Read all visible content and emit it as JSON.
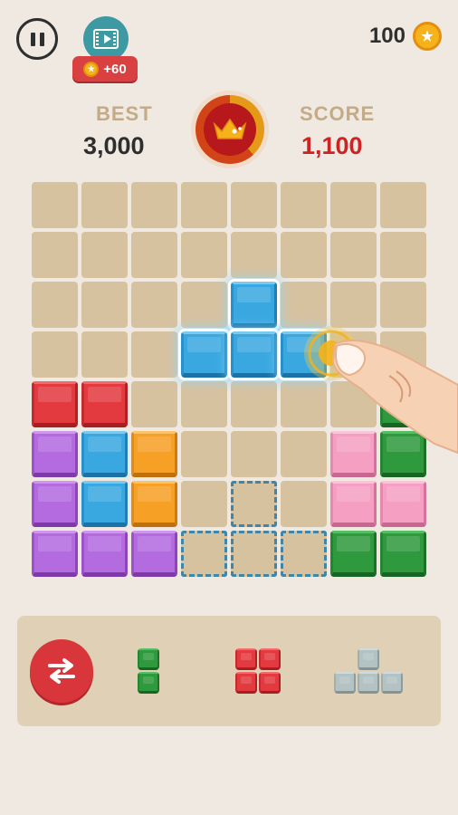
{
  "top_bar": {
    "pause_icon": "pause-icon",
    "video_icon": "video-ad-icon",
    "reward_text": "+60",
    "coins": "100"
  },
  "scores": {
    "best_label": "BEST",
    "best_value": "3,000",
    "score_label": "SCORE",
    "score_value": "1,100",
    "crown_icon": "crown-icon"
  },
  "board": {
    "rows": 8,
    "cols": 8,
    "placed_blocks": [
      {
        "row": 4,
        "col": 0,
        "color": "red"
      },
      {
        "row": 4,
        "col": 1,
        "color": "red"
      },
      {
        "row": 5,
        "col": 0,
        "color": "purple"
      },
      {
        "row": 5,
        "col": 1,
        "color": "blue"
      },
      {
        "row": 5,
        "col": 2,
        "color": "orange"
      },
      {
        "row": 6,
        "col": 0,
        "color": "purple"
      },
      {
        "row": 6,
        "col": 1,
        "color": "blue"
      },
      {
        "row": 6,
        "col": 2,
        "color": "orange"
      },
      {
        "row": 7,
        "col": 0,
        "color": "purple"
      },
      {
        "row": 7,
        "col": 1,
        "color": "purple"
      },
      {
        "row": 7,
        "col": 2,
        "color": "purple"
      },
      {
        "row": 4,
        "col": 7,
        "color": "green"
      },
      {
        "row": 5,
        "col": 6,
        "color": "pink"
      },
      {
        "row": 5,
        "col": 7,
        "color": "green"
      },
      {
        "row": 6,
        "col": 6,
        "color": "pink"
      },
      {
        "row": 6,
        "col": 7,
        "color": "pink"
      },
      {
        "row": 7,
        "col": 6,
        "color": "green"
      },
      {
        "row": 7,
        "col": 7,
        "color": "green"
      }
    ],
    "dragging_piece": [
      {
        "row": 2,
        "col": 4
      },
      {
        "row": 3,
        "col": 3
      },
      {
        "row": 3,
        "col": 4
      },
      {
        "row": 3,
        "col": 5
      }
    ],
    "ghost_target": [
      {
        "row": 6,
        "col": 4
      },
      {
        "row": 7,
        "col": 3
      },
      {
        "row": 7,
        "col": 4
      },
      {
        "row": 7,
        "col": 5
      }
    ]
  },
  "tray": {
    "swap_icon": "swap-arrows-icon",
    "pieces": [
      {
        "name": "green-vertical-2",
        "color": "green",
        "cells": [
          [
            0,
            0
          ],
          [
            1,
            0
          ]
        ]
      },
      {
        "name": "red-square-2x2",
        "color": "red",
        "cells": [
          [
            0,
            0
          ],
          [
            0,
            1
          ],
          [
            1,
            0
          ],
          [
            1,
            1
          ]
        ]
      },
      {
        "name": "gray-t-piece",
        "color": "lightgray",
        "cells": [
          [
            0,
            1
          ],
          [
            1,
            0
          ],
          [
            1,
            1
          ],
          [
            1,
            2
          ]
        ]
      }
    ]
  },
  "colors": {
    "background": "#efe9e1",
    "empty_cell": "#d7c2a0",
    "score_red": "#cf2323",
    "label_tan": "#c3ab87",
    "blue_block": "#3aa8e0"
  }
}
